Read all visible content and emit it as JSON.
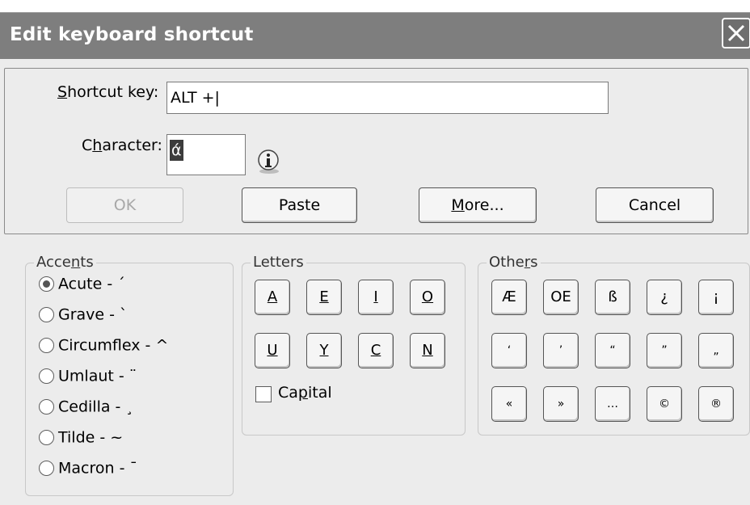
{
  "window": {
    "title": "Edit keyboard shortcut",
    "close_glyph": "✕"
  },
  "shortcut": {
    "label": "Shortcut key:",
    "value": "ALT +|"
  },
  "character": {
    "label": "Character:",
    "value": "ά"
  },
  "buttons": {
    "ok": "OK",
    "paste": "Paste",
    "more": "More...",
    "cancel": "Cancel"
  },
  "accents": {
    "title": "Accents",
    "selected": "Acute",
    "options": [
      "Acute - ´",
      "Grave - `",
      "Circumflex - ^",
      "Umlaut - ¨",
      "Cedilla - ¸",
      "Tilde - ~",
      "Macron - ¯"
    ]
  },
  "letters": {
    "title": "Letters",
    "keys": [
      "A",
      "E",
      "I",
      "O",
      "U",
      "Y",
      "C",
      "N"
    ],
    "capital_label": "Capital",
    "capital_checked": false
  },
  "others": {
    "title": "Others",
    "keys": [
      "Æ",
      "OE",
      "ß",
      "¿",
      "¡",
      "‘",
      "’",
      "“",
      "”",
      "„",
      "«",
      "»",
      "…",
      "©",
      "®"
    ]
  }
}
